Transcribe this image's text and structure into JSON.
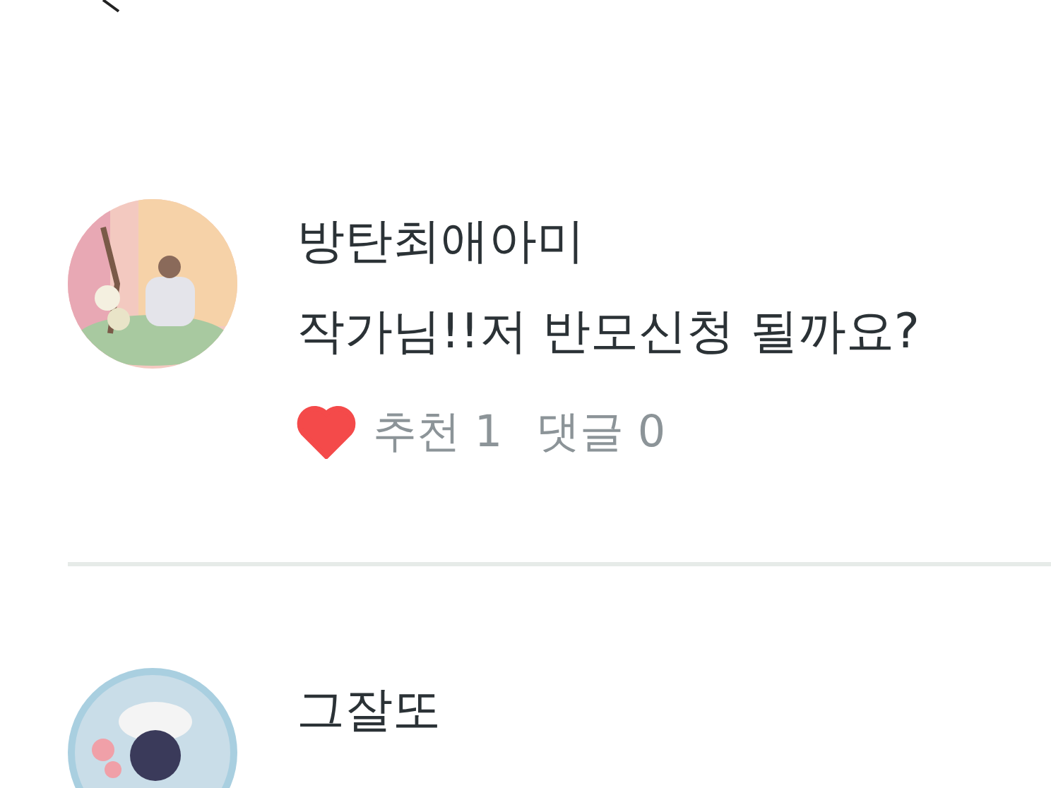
{
  "comments": [
    {
      "author": "방탄최애아미",
      "text": "작가님!!저 반모신청 될까요?",
      "liked": true,
      "likes": "추천 1",
      "replies": "댓글 0"
    },
    {
      "author": "그잘또"
    }
  ]
}
